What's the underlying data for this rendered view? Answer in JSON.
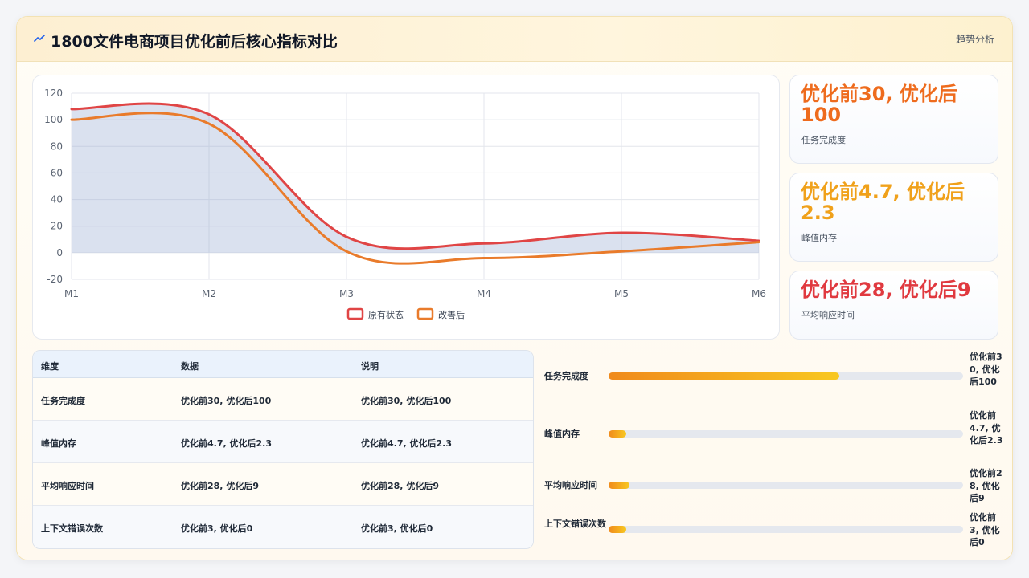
{
  "header": {
    "title": "1800文件电商项目优化前后核心指标对比",
    "trend_link": "趋势分析"
  },
  "chart_data": {
    "type": "line",
    "title": "",
    "xlabel": "",
    "ylabel": "",
    "categories": [
      "M1",
      "M2",
      "M3",
      "M4",
      "M5",
      "M6"
    ],
    "ylim": [
      -20,
      120
    ],
    "yticks": [
      120,
      100,
      80,
      60,
      40,
      20,
      0,
      -20
    ],
    "grid": true,
    "legend_position": "bottom",
    "series": [
      {
        "name": "原有状态",
        "color": "#e04545",
        "fill": true,
        "values": [
          108,
          104,
          12,
          7,
          15,
          9
        ]
      },
      {
        "name": "改善后",
        "color": "#e97b2b",
        "fill": false,
        "values": [
          100,
          97,
          1,
          -4,
          1,
          8
        ]
      }
    ]
  },
  "metrics": [
    {
      "value": "优化前30, 优化后100",
      "label": "任务完成度",
      "color": "#ee6b1d"
    },
    {
      "value": "优化前4.7, 优化后2.3",
      "label": "峰值内存",
      "color": "#f0a11b"
    },
    {
      "value": "优化前28, 优化后9",
      "label": "平均响应时间",
      "color": "#e0393f"
    }
  ],
  "table": {
    "headers": [
      "维度",
      "数据",
      "说明"
    ],
    "rows": [
      [
        "任务完成度",
        "优化前30, 优化后100",
        "优化前30, 优化后100"
      ],
      [
        "峰值内存",
        "优化前4.7, 优化后2.3",
        "优化前4.7, 优化后2.3"
      ],
      [
        "平均响应时间",
        "优化前28, 优化后9",
        "优化前28, 优化后9"
      ],
      [
        "上下文错误次数",
        "优化前3, 优化后0",
        "优化前3, 优化后0"
      ]
    ]
  },
  "bars": [
    {
      "label": "任务完成度",
      "value": "优化前30, 优化后100",
      "fill_fraction": 0.65
    },
    {
      "label": "峰值内存",
      "value": "优化前4.7, 优化后2.3",
      "fill_fraction": 0.05
    },
    {
      "label": "平均响应时间",
      "value": "优化前28, 优化后9",
      "fill_fraction": 0.06
    },
    {
      "label": "上下文错误次数",
      "value": "优化前3, 优化后0",
      "fill_fraction": 0.05
    }
  ]
}
